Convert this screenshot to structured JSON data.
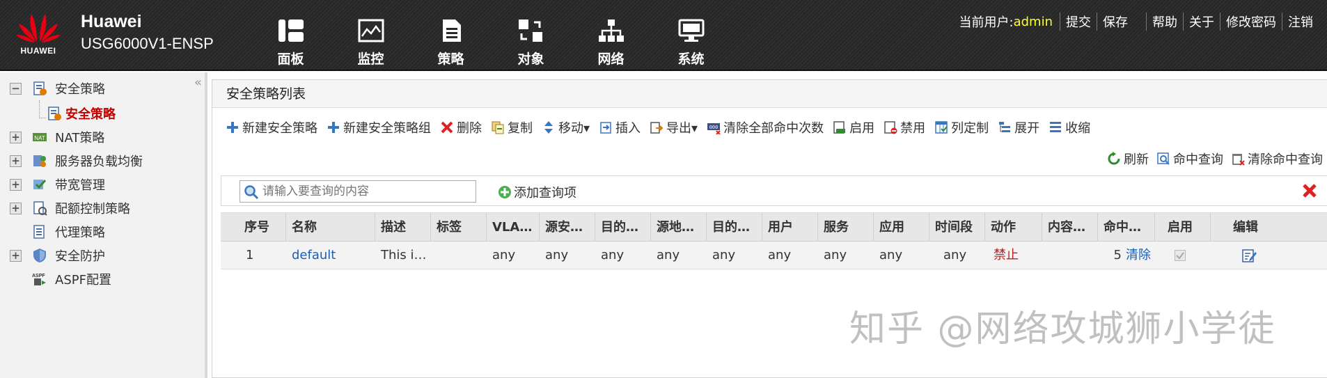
{
  "header": {
    "logo_text": "HUAWEI",
    "brand_name": "Huawei",
    "model": "USG6000V1-ENSP",
    "nav": [
      {
        "label": "面板",
        "icon": "dashboard-icon"
      },
      {
        "label": "监控",
        "icon": "monitor-icon"
      },
      {
        "label": "策略",
        "icon": "policy-icon"
      },
      {
        "label": "对象",
        "icon": "object-icon"
      },
      {
        "label": "网络",
        "icon": "network-icon"
      },
      {
        "label": "系统",
        "icon": "system-icon"
      }
    ],
    "current_user_label": "当前用户:",
    "current_user": "admin",
    "links": [
      "提交",
      "保存",
      "帮助",
      "关于",
      "修改密码",
      "注销"
    ]
  },
  "sidebar": {
    "collapse_glyph": "«",
    "items": [
      {
        "label": "安全策略",
        "expand": "−",
        "icon": "security-policy-icon"
      },
      {
        "label": "安全策略",
        "expand": "",
        "icon": "security-policy-icon",
        "selected": true
      },
      {
        "label": "NAT策略",
        "expand": "+",
        "icon": "nat-icon"
      },
      {
        "label": "服务器负载均衡",
        "expand": "+",
        "icon": "load-balance-icon"
      },
      {
        "label": "带宽管理",
        "expand": "+",
        "icon": "bandwidth-icon"
      },
      {
        "label": "配额控制策略",
        "expand": "+",
        "icon": "quota-icon"
      },
      {
        "label": "代理策略",
        "expand": "",
        "icon": "proxy-icon"
      },
      {
        "label": "安全防护",
        "expand": "+",
        "icon": "shield-icon"
      },
      {
        "label": "ASPF配置",
        "expand": "",
        "icon": "aspf-icon"
      }
    ]
  },
  "main": {
    "title": "安全策略列表",
    "toolbar": [
      {
        "label": "新建安全策略",
        "icon": "plus-icon"
      },
      {
        "label": "新建安全策略组",
        "icon": "plus-icon"
      },
      {
        "label": "删除",
        "icon": "delete-icon"
      },
      {
        "label": "复制",
        "icon": "copy-icon"
      },
      {
        "label": "移动▾",
        "icon": "move-icon"
      },
      {
        "label": "插入",
        "icon": "insert-icon"
      },
      {
        "label": "导出▾",
        "icon": "export-icon"
      },
      {
        "label": "清除全部命中次数",
        "icon": "clear-hits-icon"
      },
      {
        "label": "启用",
        "icon": "enable-icon"
      },
      {
        "label": "禁用",
        "icon": "disable-icon"
      },
      {
        "label": "列定制",
        "icon": "columns-icon"
      },
      {
        "label": "展开",
        "icon": "expand-icon"
      },
      {
        "label": "收缩",
        "icon": "collapse-icon"
      }
    ],
    "toolbar2": [
      {
        "label": "刷新",
        "icon": "refresh-icon"
      },
      {
        "label": "命中查询",
        "icon": "hit-query-icon"
      },
      {
        "label": "清除命中查询",
        "icon": "clear-hit-query-icon"
      }
    ],
    "search_placeholder": "请输入要查询的内容",
    "add_query": "添加查询项",
    "columns": [
      "序号",
      "名称",
      "描述",
      "标签",
      "VLA…",
      "源安…",
      "目的…",
      "源地…",
      "目的…",
      "用户",
      "服务",
      "应用",
      "时间段",
      "动作",
      "内容…",
      "命中…",
      "启用",
      "编辑"
    ],
    "rows": [
      {
        "index": "1",
        "name": "default",
        "desc": "This i…",
        "tag": "",
        "vlan": "any",
        "src_zone": "any",
        "dst_zone": "any",
        "src_addr": "any",
        "dst_addr": "any",
        "user": "any",
        "service": "any",
        "app": "any",
        "time": "any",
        "action": "禁止",
        "content": "",
        "hits": "5",
        "clear_label": "清除",
        "enabled": true
      }
    ]
  },
  "watermark": "知乎 @网络攻城狮小学徒",
  "colors": {
    "accent_red": "#c00000",
    "user_yellow": "#ffff33",
    "link_blue": "#1a5fb4"
  }
}
